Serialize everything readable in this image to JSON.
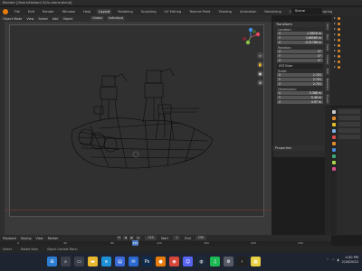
{
  "titlebar": {
    "title": "Blender [/Users/Holland 2/Un-drone.blend]"
  },
  "topbar": {
    "tabs": [
      "File",
      "Edit",
      "Render",
      "Window",
      "Help",
      "Layout",
      "Modeling",
      "Sculpting",
      "UV Editing",
      "Texture Paint",
      "Shading",
      "Animation",
      "Rendering",
      "Compositing",
      "Scripting"
    ],
    "active_tab": "Layout",
    "scene": "Scene"
  },
  "viewport_header": {
    "menus": [
      "Object Mode",
      "View",
      "Select",
      "Add",
      "Object"
    ],
    "orientation": "Global",
    "pivot": "Individual"
  },
  "npanel": {
    "title": "Transform",
    "location": {
      "label": "Location:",
      "x": "-2.6818 m",
      "y": "4.86569 m",
      "z": "-0.21788 m"
    },
    "rotation": {
      "label": "Rotation:",
      "x": "0°",
      "y": "0°",
      "z": "0°",
      "mode": "XYZ Euler"
    },
    "scale": {
      "label": "Scale:",
      "x": "2.701",
      "y": "2.701",
      "z": "2.701"
    },
    "dimensions": {
      "label": "Dimensions:",
      "x": "5.388 m",
      "y": "9.46 m",
      "z": "4.97 m"
    },
    "properties_label": "Properties"
  },
  "sidetabs": [
    "Item",
    "Tool",
    "View",
    "Create",
    "Edit",
    "HardOps",
    "Fluent"
  ],
  "timeline": {
    "menus": [
      "Playback",
      "Keying",
      "View",
      "Marker"
    ],
    "start_label": "Start",
    "start": "1",
    "end_label": "End",
    "end": "250",
    "current_frame": "120",
    "ticks": [
      "0",
      "40",
      "80",
      "120",
      "160",
      "200",
      "240"
    ]
  },
  "statusbar": {
    "hints": [
      "Select",
      "Rotate View",
      "Object Context Menu"
    ]
  },
  "taskbar": {
    "apps": [
      "start",
      "search",
      "task-view",
      "explorer",
      "edge",
      "store",
      "mail",
      "photoshop",
      "blender",
      "chrome",
      "discord",
      "steam",
      "spotify",
      "settings",
      "terminal",
      "notes"
    ],
    "time": "4:40 PM",
    "date": "2/18/2022"
  },
  "colors": {
    "accent": "#4b79c4",
    "blender_orange": "#e87d0d",
    "x_axis": "#e4475b",
    "y_axis": "#8bc34a",
    "z_axis": "#3d8fe8"
  }
}
